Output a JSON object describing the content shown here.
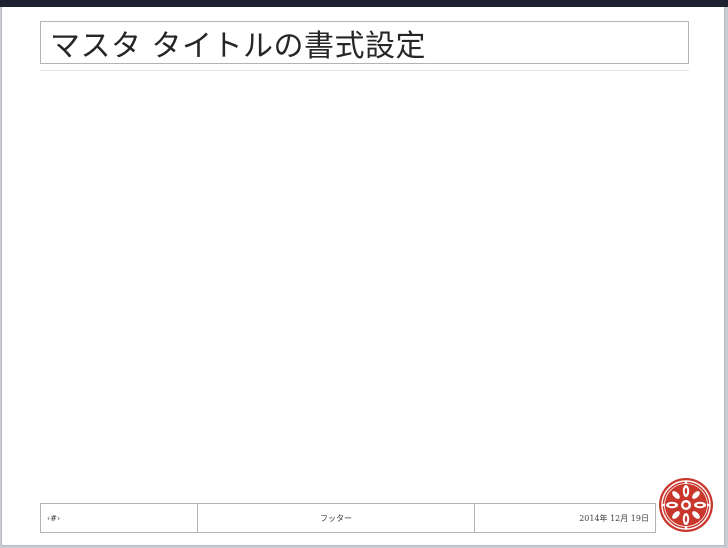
{
  "slide": {
    "title": "マスタ タイトルの書式設定",
    "footer": {
      "slide_number": "‹#›",
      "center_text": "フッター",
      "date": "2014年 12月 19日"
    }
  },
  "colors": {
    "logo_red": "#c9372c",
    "border_gray": "#b3b3b3",
    "window_frame": "#1c2230"
  },
  "icons": {
    "logo": "ornamental-emblem-icon"
  }
}
